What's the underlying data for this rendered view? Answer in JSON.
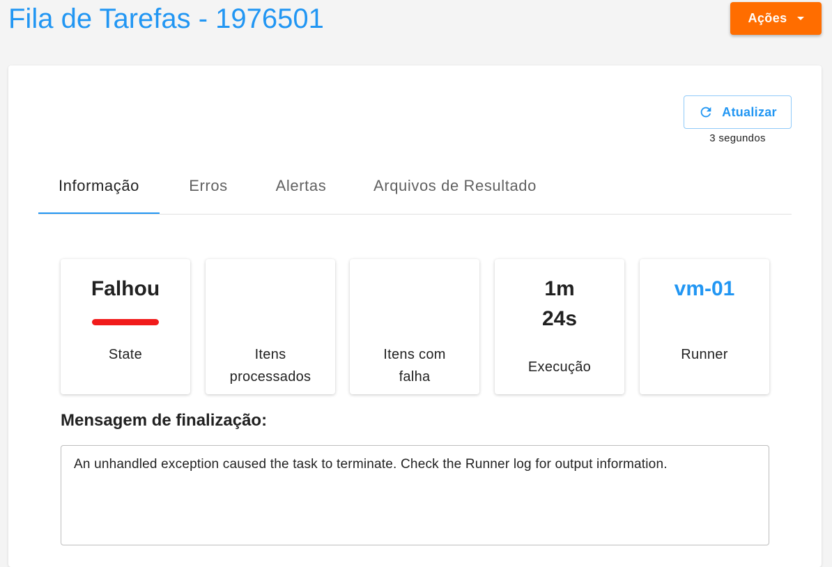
{
  "header": {
    "title": "Fila de Tarefas - 1976501",
    "actions_label": "Ações"
  },
  "refresh": {
    "label": "Atualizar",
    "elapsed": "3 segundos"
  },
  "tabs": [
    {
      "label": "Informação",
      "active": true
    },
    {
      "label": "Erros",
      "active": false
    },
    {
      "label": "Alertas",
      "active": false
    },
    {
      "label": "Arquivos de Resultado",
      "active": false
    }
  ],
  "stats": {
    "state": {
      "value": "Falhou",
      "label": "State"
    },
    "processed": {
      "value": "",
      "label_line1": "Itens",
      "label_line2": "processados"
    },
    "failed": {
      "value": "",
      "label_line1": "Itens com",
      "label_line2": "falha"
    },
    "execution": {
      "value_line1": "1m",
      "value_line2": "24s",
      "label": "Execução"
    },
    "runner": {
      "value": "vm-01",
      "label": "Runner"
    }
  },
  "completion": {
    "heading": "Mensagem de finalização:",
    "message": "An unhandled exception caused the task to terminate. Check the Runner log for output information."
  },
  "colors": {
    "accent": "#2196f3",
    "actions": "#ff6d00",
    "failed_state": "#f11b1b"
  }
}
